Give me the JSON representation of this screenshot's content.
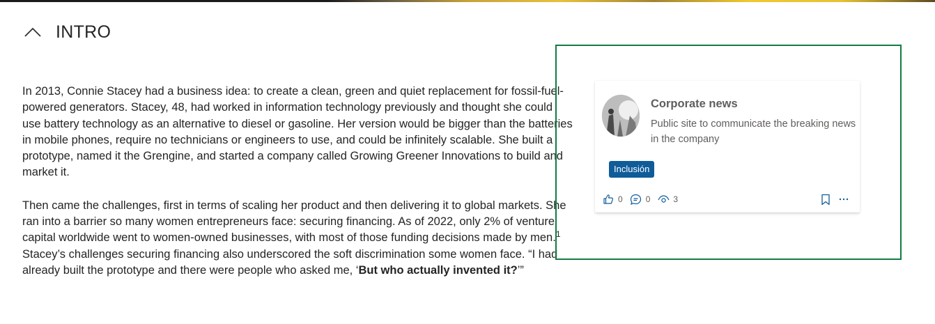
{
  "section": {
    "title": "INTRO",
    "toggle_icon": "chevron-up-icon"
  },
  "article": {
    "paragraph1": "In 2013, Connie Stacey had a business idea: to create a clean, green and quiet replacement for fossil-fuel-powered generators. Stacey, 48, had worked in information technology previously and thought she could use battery technology as an alternative to diesel or gasoline. Her version would be bigger than the batteries in mobile phones, require no technicians or engineers to use, and could be infinitely scalable. She built a prototype, named it the Grengine, and started a company called Growing Greener Innovations to build and market it.",
    "paragraph2": "Then came the challenges, first in terms of scaling her product and then delivering it to global markets. She ran into a barrier so many women entrepreneurs face: securing financing. As of 2022, only 2% of venture capital worldwide went to women-owned businesses, with most of those funding decisions made by men.",
    "footnote": "1",
    "paragraph2_cont": " Stacey’s challenges securing financing also underscored the soft discrimination some women face. “I had already built the prototype and there were people who asked me, ‘",
    "quote_bold": "But who actually invented it?",
    "quote_end": "’”"
  },
  "card": {
    "title": "Corporate news",
    "description": "Public site to communicate the breaking news in the company",
    "tag": "Inclusión",
    "likes": "0",
    "comments": "0",
    "views": "3",
    "colors": {
      "tag_bg": "#0f5c99",
      "selection_border": "#107c41"
    }
  }
}
